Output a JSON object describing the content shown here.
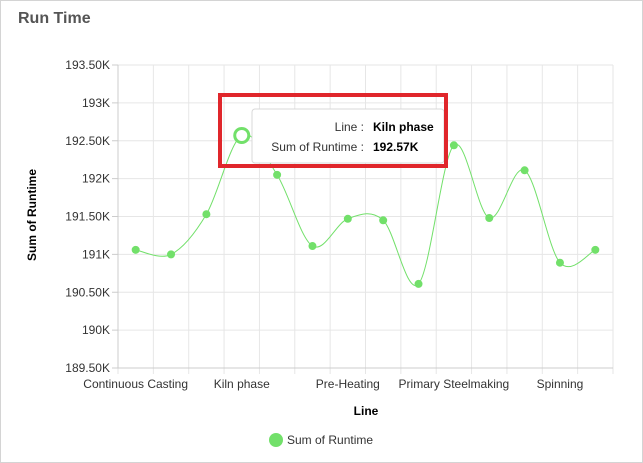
{
  "panel": {
    "title": "Run Time"
  },
  "chart_data": {
    "type": "line",
    "x": [
      "Continuous Casting",
      "",
      "",
      "Kiln phase",
      "",
      "",
      "Pre-Heating",
      "",
      "",
      "Primary Steelmaking",
      "",
      "",
      "Spinning",
      ""
    ],
    "x_tick_labels": [
      "Continuous Casting",
      "Kiln phase",
      "Pre-Heating",
      "Primary Steelmaking",
      "Spinning"
    ],
    "series": [
      {
        "name": "Sum of Runtime",
        "color": "#72e06a",
        "values": [
          191060,
          191000,
          191530,
          192570,
          192050,
          191110,
          191470,
          191450,
          190610,
          192440,
          191480,
          192110,
          190890,
          191060
        ]
      }
    ],
    "ylim": [
      189500,
      193500
    ],
    "y_ticks": [
      {
        "value": 193500,
        "label": "193.50K"
      },
      {
        "value": 193000,
        "label": "193K"
      },
      {
        "value": 192500,
        "label": "192.50K"
      },
      {
        "value": 192000,
        "label": "192K"
      },
      {
        "value": 191500,
        "label": "191.50K"
      },
      {
        "value": 191000,
        "label": "191K"
      },
      {
        "value": 190500,
        "label": "190.50K"
      },
      {
        "value": 190000,
        "label": "190K"
      },
      {
        "value": 189500,
        "label": "189.50K"
      }
    ],
    "xlabel": "Line",
    "ylabel": "Sum of Runtime",
    "grid": true,
    "legend": {
      "position": "bottom-center",
      "label": "Sum of Runtime"
    },
    "highlight_index": 3,
    "tooltip": {
      "line_label": "Line :",
      "line_value": "Kiln phase",
      "runtime_label": "Sum of Runtime :",
      "runtime_value": "192.57K"
    }
  },
  "colors": {
    "series": "#72e06a",
    "highlight_box": "#e0262b",
    "grid": "#e6e6e6"
  }
}
